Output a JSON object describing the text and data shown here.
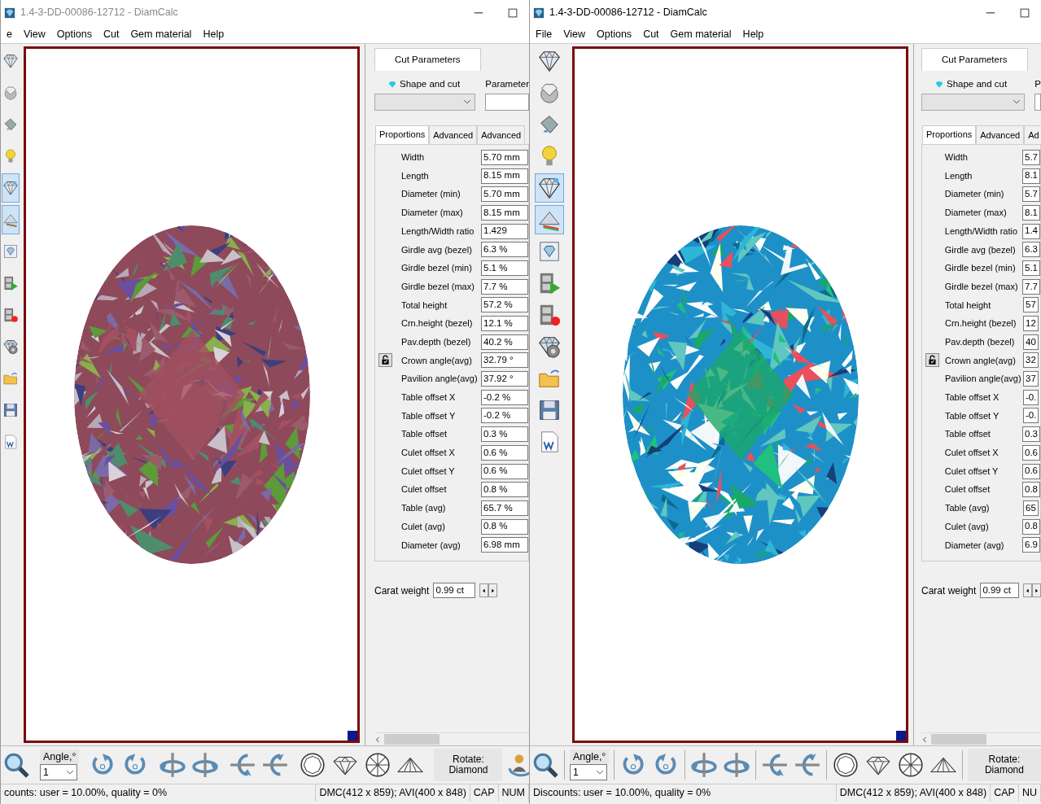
{
  "windows": [
    {
      "title": "1.4-3-DD-00086-12712 - DiamCalc",
      "menu": [
        "e",
        "View",
        "Options",
        "Cut",
        "Gem material",
        "Help"
      ],
      "side_tools": [
        {
          "pressed": false
        },
        {
          "pressed": false
        },
        {
          "pressed": false
        },
        {
          "pressed": false
        },
        {
          "pressed": true
        },
        {
          "pressed": true
        },
        {
          "pressed": false
        },
        {
          "pressed": false
        },
        {
          "pressed": false
        },
        {
          "pressed": false
        },
        {
          "pressed": false
        },
        {
          "pressed": false
        },
        {
          "pressed": false
        }
      ],
      "panel_tab": {
        "label": "Cut Parameters",
        "selected": true
      },
      "shape_label": "Shape and cut",
      "parameters_label": "Parameter",
      "sub_tabs": [
        {
          "label": "Proportions",
          "selected": true
        },
        {
          "label": "Advanced",
          "selected": false
        },
        {
          "label": "Advanced",
          "selected": false
        }
      ],
      "params": [
        {
          "kind": "plain",
          "label": "Width",
          "value": "5.70 mm"
        },
        {
          "kind": "plain",
          "label": "Length",
          "value": "8.15 mm"
        },
        {
          "kind": "plain",
          "label": "Diameter (min)",
          "value": "5.70 mm"
        },
        {
          "kind": "plain",
          "label": "Diameter (max)",
          "value": "8.15 mm"
        },
        {
          "kind": "plain",
          "label": "Length/Width ratio",
          "value": "1.429"
        },
        {
          "kind": "plain",
          "label": "Girdle avg (bezel)",
          "value": "6.3 %"
        },
        {
          "kind": "plain",
          "label": "Girdle bezel (min)",
          "value": "5.1 %"
        },
        {
          "kind": "plain",
          "label": "Girdle bezel (max)",
          "value": "7.7 %"
        },
        {
          "kind": "plain",
          "label": "Total height",
          "value": "57.2 %"
        },
        {
          "kind": "plain",
          "label": "Crn.height (bezel)",
          "value": "12.1 %"
        },
        {
          "kind": "plain",
          "label": "Pav.depth (bezel)",
          "value": "40.2 %"
        },
        {
          "kind": "lock",
          "label": "Crown angle(avg)",
          "value": "32.79 °"
        },
        {
          "kind": "plain",
          "label": "Pavilion angle(avg)",
          "value": "37.92 °"
        },
        {
          "kind": "plain",
          "label": "Table offset X",
          "value": "-0.2 %"
        },
        {
          "kind": "plain",
          "label": "Table offset Y",
          "value": "-0.2 %"
        },
        {
          "kind": "plain",
          "label": "Table offset",
          "value": "0.3 %"
        },
        {
          "kind": "plain",
          "label": "Culet offset X",
          "value": "0.6 %"
        },
        {
          "kind": "plain",
          "label": "Culet offset Y",
          "value": "0.6 %"
        },
        {
          "kind": "plain",
          "label": "Culet offset",
          "value": "0.8 %"
        },
        {
          "kind": "plain",
          "label": "Table (avg)",
          "value": "65.7 %"
        },
        {
          "kind": "plain",
          "label": "Culet (avg)",
          "value": "0.8 %"
        },
        {
          "kind": "plain",
          "label": "Diameter (avg)",
          "value": "6.98 mm"
        }
      ],
      "carat_label": "Carat weight",
      "carat_value": "0.99 ct",
      "angle_label": "Angle,°",
      "angle_value": "1",
      "rotate_label": "Rotate: Diamond",
      "user_rotate_button": true,
      "status": [
        "counts: user = 10.00%, quality = 0%",
        "DMC(412 x 859); AVI(400 x 848)",
        "CAP",
        "NUM"
      ]
    },
    {
      "title": "1.4-3-DD-00086-12712 - DiamCalc",
      "menu": [
        "File",
        "View",
        "Options",
        "Cut",
        "Gem material",
        "Help"
      ],
      "side_tools": [
        {
          "pressed": false
        },
        {
          "pressed": false
        },
        {
          "pressed": false
        },
        {
          "pressed": false
        },
        {
          "pressed": true
        },
        {
          "pressed": true
        },
        {
          "pressed": false
        },
        {
          "pressed": false
        },
        {
          "pressed": false
        },
        {
          "pressed": false
        },
        {
          "pressed": false
        },
        {
          "pressed": false
        },
        {
          "pressed": false
        }
      ],
      "panel_tab": {
        "label": "Cut Parameters",
        "selected": true
      },
      "shape_label": "Shape and cut",
      "parameters_label": "P",
      "sub_tabs": [
        {
          "label": "Proportions",
          "selected": true
        },
        {
          "label": "Advanced",
          "selected": false
        },
        {
          "label": "Ad",
          "selected": false
        }
      ],
      "params": [
        {
          "kind": "plain",
          "label": "Width",
          "value": "5.7"
        },
        {
          "kind": "plain",
          "label": "Length",
          "value": "8.1"
        },
        {
          "kind": "plain",
          "label": "Diameter (min)",
          "value": "5.7"
        },
        {
          "kind": "plain",
          "label": "Diameter (max)",
          "value": "8.1"
        },
        {
          "kind": "plain",
          "label": "Length/Width ratio",
          "value": "1.4"
        },
        {
          "kind": "plain",
          "label": "Girdle avg (bezel)",
          "value": "6.3"
        },
        {
          "kind": "plain",
          "label": "Girdle bezel (min)",
          "value": "5.1"
        },
        {
          "kind": "plain",
          "label": "Girdle bezel (max)",
          "value": "7.7"
        },
        {
          "kind": "plain",
          "label": "Total height",
          "value": "57"
        },
        {
          "kind": "plain",
          "label": "Crn.height (bezel)",
          "value": "12"
        },
        {
          "kind": "plain",
          "label": "Pav.depth (bezel)",
          "value": "40"
        },
        {
          "kind": "lock",
          "label": "Crown angle(avg)",
          "value": "32"
        },
        {
          "kind": "plain",
          "label": "Pavilion angle(avg)",
          "value": "37"
        },
        {
          "kind": "plain",
          "label": "Table offset X",
          "value": "-0."
        },
        {
          "kind": "plain",
          "label": "Table offset Y",
          "value": "-0."
        },
        {
          "kind": "plain",
          "label": "Table offset",
          "value": "0.3"
        },
        {
          "kind": "plain",
          "label": "Culet offset X",
          "value": "0.6"
        },
        {
          "kind": "plain",
          "label": "Culet offset Y",
          "value": "0.6"
        },
        {
          "kind": "plain",
          "label": "Culet offset",
          "value": "0.8"
        },
        {
          "kind": "plain",
          "label": "Table (avg)",
          "value": "65"
        },
        {
          "kind": "plain",
          "label": "Culet (avg)",
          "value": "0.8"
        },
        {
          "kind": "plain",
          "label": "Diameter (avg)",
          "value": "6.9"
        }
      ],
      "carat_label": "Carat weight",
      "carat_value": "0.99 ct",
      "angle_label": "Angle,°",
      "angle_value": "1",
      "rotate_label": "Rotate: Diamond",
      "user_rotate_button": false,
      "status": [
        "Discounts: user = 10.00%, quality = 0%",
        "DMC(412 x 859); AVI(400 x 848)",
        "CAP",
        "NU"
      ]
    }
  ]
}
